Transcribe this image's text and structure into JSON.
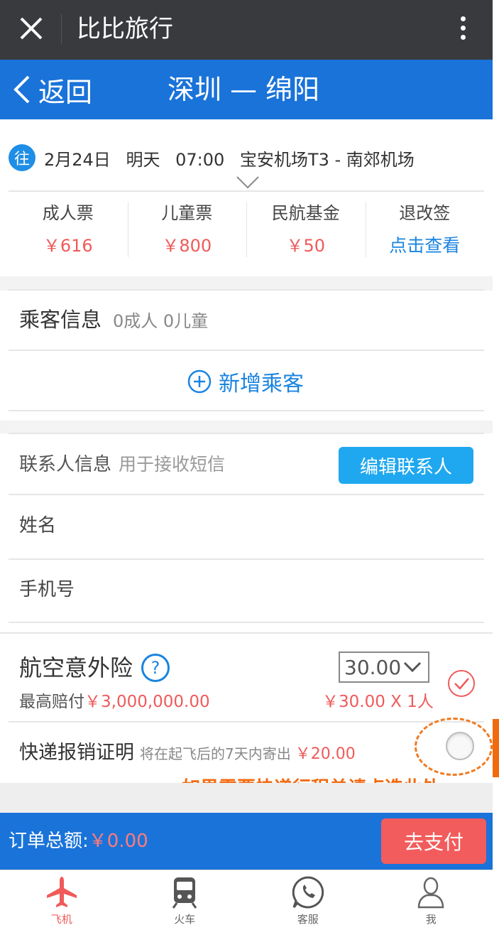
{
  "wechat": {
    "title": "比比旅行"
  },
  "nav": {
    "back_label": "返回",
    "route": "深圳 — 绵阳"
  },
  "flight": {
    "badge": "往",
    "date": "2月24日",
    "day": "明天",
    "time": "07:00",
    "airports": "宝安机场T3 - 南郊机场"
  },
  "fares": [
    {
      "label": "成人票",
      "value": "￥616"
    },
    {
      "label": "儿童票",
      "value": "￥800"
    },
    {
      "label": "民航基金",
      "value": "￥50"
    },
    {
      "label": "退改签",
      "value": "点击查看"
    }
  ],
  "passenger": {
    "title": "乘客信息",
    "count": "0成人  0儿童",
    "add_label": "新增乘客"
  },
  "contact": {
    "title": "联系人信息",
    "subtitle": "用于接收短信",
    "edit_label": "编辑联系人",
    "name_label": "姓名",
    "phone_label": "手机号"
  },
  "insurance": {
    "title": "航空意外险",
    "help": "?",
    "selected": "30.00",
    "max_label": "最高赔付",
    "max_value": "￥3,000,000.00",
    "price": "￥30.00 X 1人"
  },
  "express": {
    "title": "快递报销证明",
    "subtitle": "将在起飞后的7天内寄出",
    "price": "￥20.00",
    "hint": "如果需要快递行程单请点选此处"
  },
  "total": {
    "label": "订单总额:",
    "value": "￥0.00",
    "pay_label": "去支付"
  },
  "tabs": [
    {
      "label": "飞机",
      "icon": "plane-icon",
      "active": true
    },
    {
      "label": "火车",
      "icon": "train-icon"
    },
    {
      "label": "客服",
      "icon": "customer-service-icon"
    },
    {
      "label": "我",
      "icon": "user-icon"
    }
  ],
  "colors": {
    "nav_blue": "#1a73d9",
    "price_red": "#f05a5a",
    "link_blue": "#1a84e0",
    "hint_orange": "#f26a10"
  }
}
